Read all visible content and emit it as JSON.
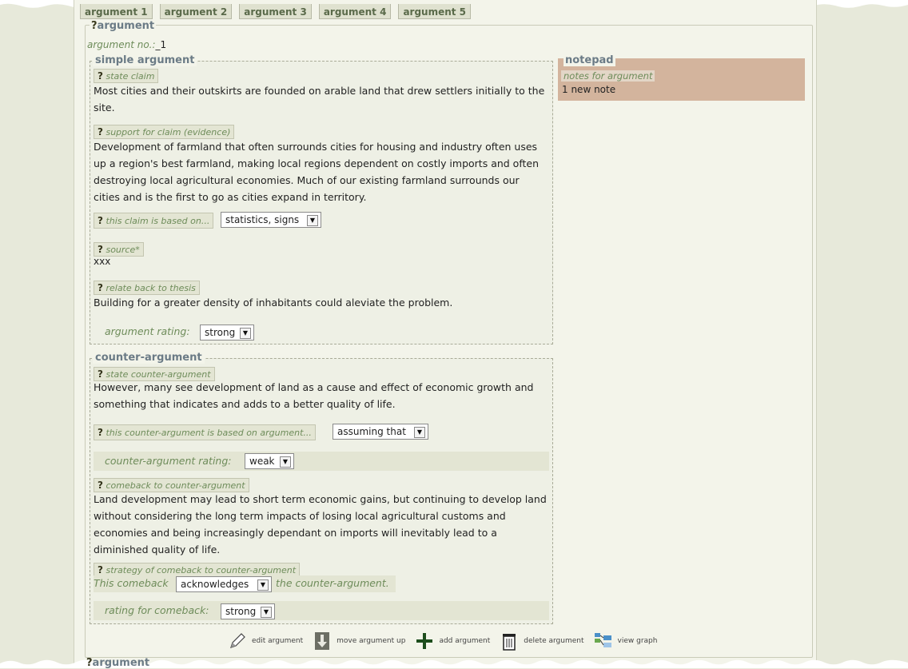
{
  "tabs": [
    "argument 1",
    "argument 2",
    "argument 3",
    "argument 4",
    "argument 5"
  ],
  "argument": {
    "legend_q": "?",
    "legend": "argument",
    "no_label": "argument no.:",
    "no_value": "_1"
  },
  "simple": {
    "title": "simple argument",
    "state_claim_label": "state claim",
    "claim_text": "Most cities and their outskirts are founded on arable land that drew settlers initially to the site.",
    "support_label": "support for claim (evidence)",
    "support_text": "Development of farmland that often surrounds cities for housing and industry often uses up a region's best farmland, making local regions dependent on costly imports and often destroying local agricultural economies. Much of our existing farmland surrounds our cities and is the first to go as cities expand in territory.",
    "based_on_label": "this claim is based on...",
    "based_on_value": "statistics, signs",
    "source_label": "source*",
    "source_value": "xxx",
    "relate_label": "relate back to thesis",
    "relate_text": "Building for a greater density of inhabitants could aleviate the problem.",
    "rating_label": "argument rating:",
    "rating_value": "strong"
  },
  "counter": {
    "title": "counter-argument",
    "state_label": "state counter-argument",
    "state_text": "However, many see development of land as a cause and effect of economic growth and something that indicates and adds to a better quality of life.",
    "based_label": "this counter-argument is based on argument...",
    "based_value": "assuming that",
    "rating_label": "counter-argument rating:",
    "rating_value": "weak",
    "comeback_label": "comeback to counter-argument",
    "comeback_text": "Land development may lead to short term economic gains, but continuing to develop land without considering the long term impacts of losing local agricultural customs and economies and being increasingly dependant on imports will inevitably lead to a diminished quality of life.",
    "strategy_label": "strategy of comeback to counter-argument",
    "strategy_prefix": "This comeback",
    "strategy_value": "acknowledges",
    "strategy_suffix": "the counter-argument.",
    "comeback_rating_label": "rating for comeback:",
    "comeback_rating_value": "strong"
  },
  "notepad": {
    "title": "notepad",
    "notes_label": "notes for argument",
    "notes_count": "1 new note"
  },
  "toolbar": {
    "edit": "edit argument",
    "move_up": "move argument up",
    "add": "add argument",
    "delete": "delete argument",
    "view_graph": "view graph"
  },
  "next_argument_legend": "argument",
  "colors": {
    "page_bg": "#e7e9da",
    "panel_bg": "#f3f4ea",
    "notepad_bg": "#d3b49d",
    "label_green": "#6e8c5a",
    "title_grey": "#6b7b86"
  }
}
